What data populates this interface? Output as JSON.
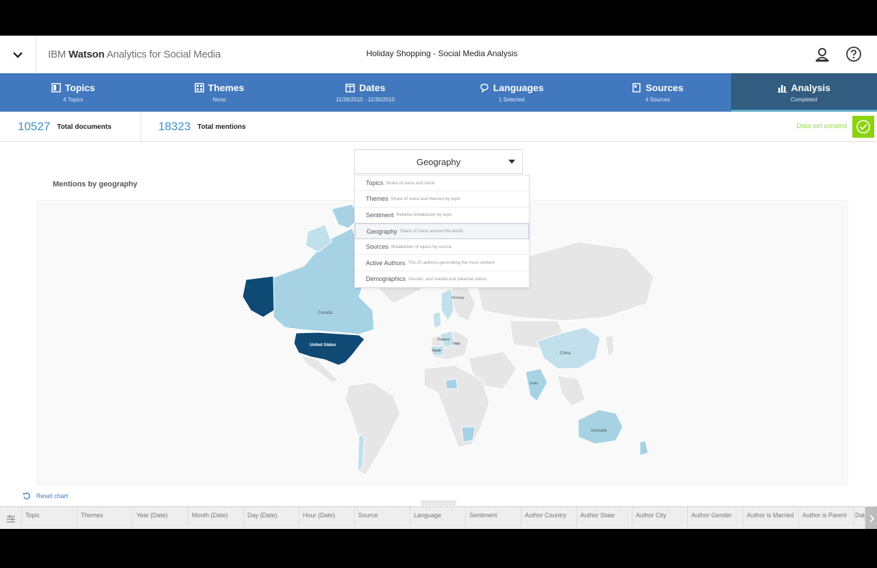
{
  "header": {
    "brand_prefix": "IBM",
    "brand_bold": "Watson",
    "brand_rest": "Analytics for Social Media",
    "project_title": "Holiday Shopping - Social Media Analysis",
    "icons": [
      "chevron-down-icon",
      "user-icon",
      "help-icon"
    ]
  },
  "nav": {
    "tabs": [
      {
        "label": "Topics",
        "sub": "4 Topics",
        "icon": "topics-icon"
      },
      {
        "label": "Themes",
        "sub": "None",
        "icon": "themes-icon"
      },
      {
        "label": "Dates",
        "sub": "11/26/2015 - 11/30/2015",
        "icon": "calendar-icon"
      },
      {
        "label": "Languages",
        "sub": "1 Selected",
        "icon": "languages-icon"
      },
      {
        "label": "Sources",
        "sub": "4 Sources",
        "icon": "sources-icon"
      },
      {
        "label": "Analysis",
        "sub": "Completed",
        "icon": "bar-chart-icon"
      }
    ],
    "active": "Analysis"
  },
  "stats": {
    "documents_value": "10527",
    "documents_label": "Total documents",
    "mentions_value": "18323",
    "mentions_label": "Total mentions",
    "status": "Data set created"
  },
  "chart": {
    "title": "Mentions by geography",
    "country_labels": [
      "Canada",
      "United States",
      "Norway",
      "France",
      "Italy",
      "Spain",
      "China",
      "India",
      "Australia"
    ]
  },
  "dropdown": {
    "selected": "Geography",
    "options": [
      {
        "name": "Topics",
        "desc": "Share of voice and trend"
      },
      {
        "name": "Themes",
        "desc": "Share of voice and themes by topic"
      },
      {
        "name": "Sentiment",
        "desc": "Relative breakdown by topic"
      },
      {
        "name": "Geography",
        "desc": "Share of voice around the world"
      },
      {
        "name": "Sources",
        "desc": "Breakdown of topics by source"
      },
      {
        "name": "Active Authors",
        "desc": "The 20 authors generating the most content"
      },
      {
        "name": "Demographics",
        "desc": "Gender, and marital and parental status"
      }
    ]
  },
  "footer": {
    "reset_label": "Reset chart",
    "columns": [
      "Topic",
      "Themes",
      "Year (Date)",
      "Month (Date)",
      "Day (Date)",
      "Hour (Date)",
      "Source",
      "Language",
      "Sentiment",
      "Author Country",
      "Author State",
      "Author City",
      "Author Gender",
      "Author is Married",
      "Author is Parent",
      "Dat"
    ]
  },
  "colors": {
    "nav_bg": "#4178be",
    "nav_active": "#325c80",
    "stat_number": "#3d8fc7",
    "success": "#8cd211",
    "map_high": "#0f4a75",
    "map_mid": "#a6d2e4",
    "map_low": "#c1e0ec",
    "map_none": "#e6e6e6"
  }
}
